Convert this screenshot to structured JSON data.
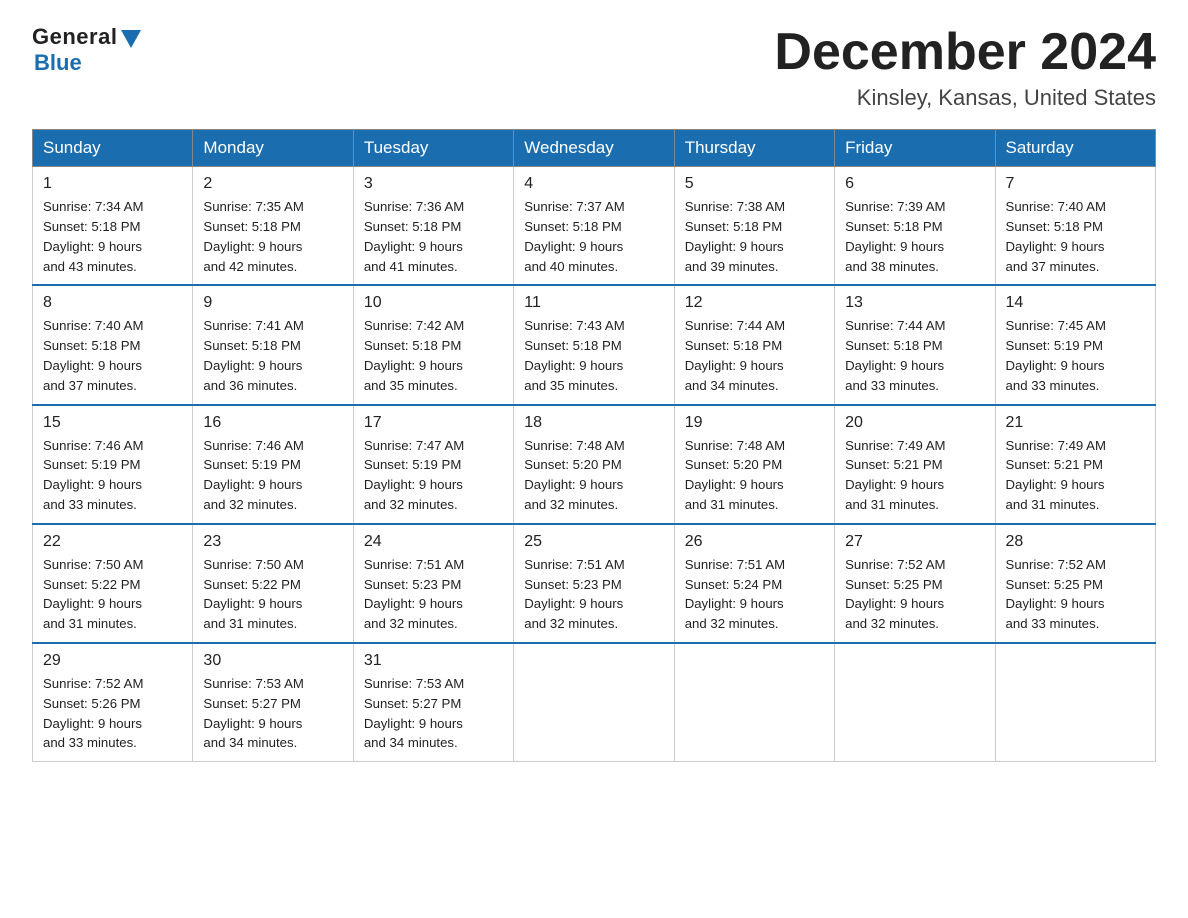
{
  "header": {
    "logo_general": "General",
    "logo_blue": "Blue",
    "month_title": "December 2024",
    "location": "Kinsley, Kansas, United States"
  },
  "weekdays": [
    "Sunday",
    "Monday",
    "Tuesday",
    "Wednesday",
    "Thursday",
    "Friday",
    "Saturday"
  ],
  "weeks": [
    [
      {
        "day": "1",
        "sunrise": "7:34 AM",
        "sunset": "5:18 PM",
        "daylight": "9 hours and 43 minutes."
      },
      {
        "day": "2",
        "sunrise": "7:35 AM",
        "sunset": "5:18 PM",
        "daylight": "9 hours and 42 minutes."
      },
      {
        "day": "3",
        "sunrise": "7:36 AM",
        "sunset": "5:18 PM",
        "daylight": "9 hours and 41 minutes."
      },
      {
        "day": "4",
        "sunrise": "7:37 AM",
        "sunset": "5:18 PM",
        "daylight": "9 hours and 40 minutes."
      },
      {
        "day": "5",
        "sunrise": "7:38 AM",
        "sunset": "5:18 PM",
        "daylight": "9 hours and 39 minutes."
      },
      {
        "day": "6",
        "sunrise": "7:39 AM",
        "sunset": "5:18 PM",
        "daylight": "9 hours and 38 minutes."
      },
      {
        "day": "7",
        "sunrise": "7:40 AM",
        "sunset": "5:18 PM",
        "daylight": "9 hours and 37 minutes."
      }
    ],
    [
      {
        "day": "8",
        "sunrise": "7:40 AM",
        "sunset": "5:18 PM",
        "daylight": "9 hours and 37 minutes."
      },
      {
        "day": "9",
        "sunrise": "7:41 AM",
        "sunset": "5:18 PM",
        "daylight": "9 hours and 36 minutes."
      },
      {
        "day": "10",
        "sunrise": "7:42 AM",
        "sunset": "5:18 PM",
        "daylight": "9 hours and 35 minutes."
      },
      {
        "day": "11",
        "sunrise": "7:43 AM",
        "sunset": "5:18 PM",
        "daylight": "9 hours and 35 minutes."
      },
      {
        "day": "12",
        "sunrise": "7:44 AM",
        "sunset": "5:18 PM",
        "daylight": "9 hours and 34 minutes."
      },
      {
        "day": "13",
        "sunrise": "7:44 AM",
        "sunset": "5:18 PM",
        "daylight": "9 hours and 33 minutes."
      },
      {
        "day": "14",
        "sunrise": "7:45 AM",
        "sunset": "5:19 PM",
        "daylight": "9 hours and 33 minutes."
      }
    ],
    [
      {
        "day": "15",
        "sunrise": "7:46 AM",
        "sunset": "5:19 PM",
        "daylight": "9 hours and 33 minutes."
      },
      {
        "day": "16",
        "sunrise": "7:46 AM",
        "sunset": "5:19 PM",
        "daylight": "9 hours and 32 minutes."
      },
      {
        "day": "17",
        "sunrise": "7:47 AM",
        "sunset": "5:19 PM",
        "daylight": "9 hours and 32 minutes."
      },
      {
        "day": "18",
        "sunrise": "7:48 AM",
        "sunset": "5:20 PM",
        "daylight": "9 hours and 32 minutes."
      },
      {
        "day": "19",
        "sunrise": "7:48 AM",
        "sunset": "5:20 PM",
        "daylight": "9 hours and 31 minutes."
      },
      {
        "day": "20",
        "sunrise": "7:49 AM",
        "sunset": "5:21 PM",
        "daylight": "9 hours and 31 minutes."
      },
      {
        "day": "21",
        "sunrise": "7:49 AM",
        "sunset": "5:21 PM",
        "daylight": "9 hours and 31 minutes."
      }
    ],
    [
      {
        "day": "22",
        "sunrise": "7:50 AM",
        "sunset": "5:22 PM",
        "daylight": "9 hours and 31 minutes."
      },
      {
        "day": "23",
        "sunrise": "7:50 AM",
        "sunset": "5:22 PM",
        "daylight": "9 hours and 31 minutes."
      },
      {
        "day": "24",
        "sunrise": "7:51 AM",
        "sunset": "5:23 PM",
        "daylight": "9 hours and 32 minutes."
      },
      {
        "day": "25",
        "sunrise": "7:51 AM",
        "sunset": "5:23 PM",
        "daylight": "9 hours and 32 minutes."
      },
      {
        "day": "26",
        "sunrise": "7:51 AM",
        "sunset": "5:24 PM",
        "daylight": "9 hours and 32 minutes."
      },
      {
        "day": "27",
        "sunrise": "7:52 AM",
        "sunset": "5:25 PM",
        "daylight": "9 hours and 32 minutes."
      },
      {
        "day": "28",
        "sunrise": "7:52 AM",
        "sunset": "5:25 PM",
        "daylight": "9 hours and 33 minutes."
      }
    ],
    [
      {
        "day": "29",
        "sunrise": "7:52 AM",
        "sunset": "5:26 PM",
        "daylight": "9 hours and 33 minutes."
      },
      {
        "day": "30",
        "sunrise": "7:53 AM",
        "sunset": "5:27 PM",
        "daylight": "9 hours and 34 minutes."
      },
      {
        "day": "31",
        "sunrise": "7:53 AM",
        "sunset": "5:27 PM",
        "daylight": "9 hours and 34 minutes."
      },
      null,
      null,
      null,
      null
    ]
  ],
  "labels": {
    "sunrise": "Sunrise:",
    "sunset": "Sunset:",
    "daylight": "Daylight:"
  }
}
